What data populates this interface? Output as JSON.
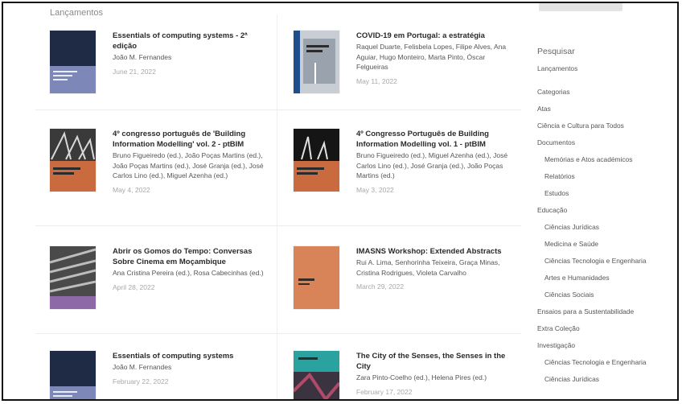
{
  "section_label": "Lançamentos",
  "books": [
    {
      "title": "Essentials of computing systems - 2ª edição",
      "authors": "João M. Fernandes",
      "date": "June 21, 2022",
      "cover_color": "#1f2b45"
    },
    {
      "title": "COVID-19 em Portugal: a estratégia",
      "authors": "Raquel Duarte, Felisbela Lopes, Filipe Alves, Ana Aguiar, Hugo Monteiro, Marta Pinto, Óscar Felgueiras",
      "date": "May 11, 2022",
      "cover_color": "#c9ced4"
    },
    {
      "title": "4º congresso português de 'Building Information Modelling' vol. 2 - ptBIM",
      "authors": "Bruno Figueiredo (ed.), João Poças Martins (ed.), João Poças Martins (ed.), José Granja (ed.), José Carlos Lino (ed.), Miguel Azenha (ed.)",
      "date": "May 4, 2022",
      "cover_color": "#c96a3f"
    },
    {
      "title": "4º Congresso Português de Building Information Modelling vol. 1 - ptBIM",
      "authors": "Bruno Figueiredo (ed.), Miguel Azenha (ed.), José Carlos Lino (ed.), José Granja (ed.), João Poças Martins (ed.)",
      "date": "May 3, 2022",
      "cover_color": "#c96a3f"
    },
    {
      "title": "Abrir os Gomos do Tempo: Conversas Sobre Cinema em Moçambique",
      "authors": "Ana Cristina Pereira (ed.), Rosa Cabecinhas (ed.)",
      "date": "April 28, 2022",
      "cover_color": "#8d6aa7"
    },
    {
      "title": "IMASNS Workshop: Extended Abstracts",
      "authors": "Rui A. Lima, Senhorinha Teixeira, Graça Minas, Cristina Rodrigues, Violeta Carvalho",
      "date": "March 29, 2022",
      "cover_color": "#d88458"
    },
    {
      "title": "Essentials of computing systems",
      "authors": "João M. Fernandes",
      "date": "February 22, 2022",
      "cover_color": "#1f2b45"
    },
    {
      "title": "The City of the Senses, the Senses in the City",
      "authors": "Zara Pinto-Coelho (ed.), Helena Pires (ed.)",
      "date": "February 17, 2022",
      "cover_color": "#2aa3a0"
    }
  ],
  "sidebar": {
    "search_heading": "Pesquisar",
    "search_link": "Lançamentos",
    "categories_heading": "Categorias",
    "items": [
      {
        "label": "Atas",
        "level": 0
      },
      {
        "label": "Ciência e Cultura para Todos",
        "level": 0
      },
      {
        "label": "Documentos",
        "level": 0
      },
      {
        "label": "Memórias e Atos académicos",
        "level": 1
      },
      {
        "label": "Relatórios",
        "level": 1
      },
      {
        "label": "Estudos",
        "level": 1
      },
      {
        "label": "Educação",
        "level": 0
      },
      {
        "label": "Ciências Jurídicas",
        "level": 1
      },
      {
        "label": "Medicina e Saúde",
        "level": 1
      },
      {
        "label": "Ciências Tecnologia e Engenharia",
        "level": 1
      },
      {
        "label": "Artes e Humanidades",
        "level": 1
      },
      {
        "label": "Ciências Sociais",
        "level": 1
      },
      {
        "label": "Ensaios para a Sustentabilidade",
        "level": 0
      },
      {
        "label": "Extra Coleção",
        "level": 0
      },
      {
        "label": "Investigação",
        "level": 0
      },
      {
        "label": "Ciências Tecnologia e Engenharia",
        "level": 1
      },
      {
        "label": "Ciências Jurídicas",
        "level": 1
      }
    ]
  }
}
